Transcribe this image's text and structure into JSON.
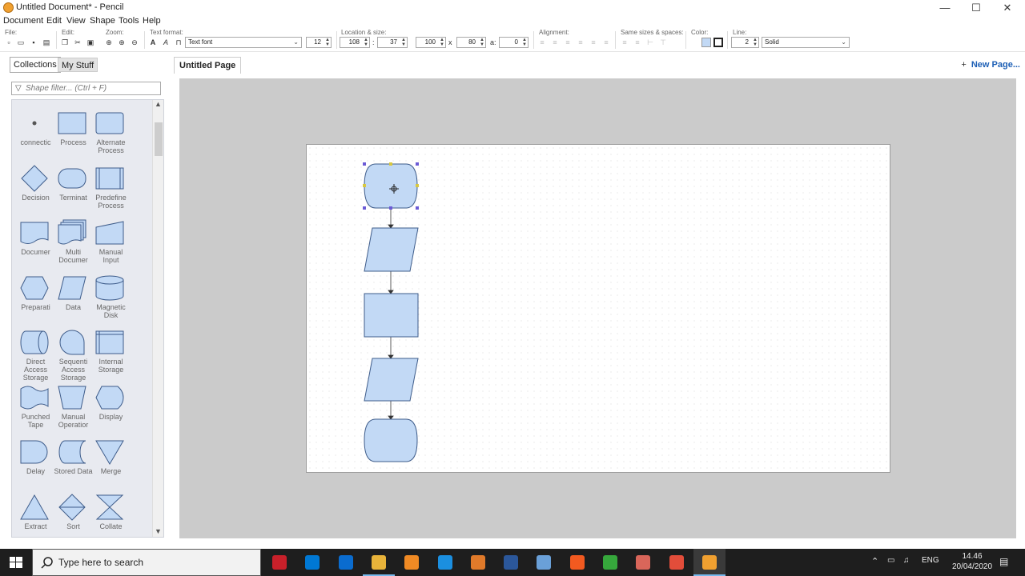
{
  "window": {
    "title": "Untitled Document* - Pencil",
    "minimize": "—",
    "maximize": "☐",
    "close": "✕"
  },
  "menu": [
    "Document",
    "Edit",
    "View",
    "Shape",
    "Tools",
    "Help"
  ],
  "toolbar": {
    "groups": {
      "file": "File:",
      "edit": "Edit:",
      "zoom": "Zoom:",
      "text_format": "Text format:",
      "location_size": "Location & size:",
      "alignment": "Alignment:",
      "same_sizes": "Same sizes & spaces:",
      "color": "Color:",
      "line": "Line:"
    },
    "font": "Text font",
    "font_size": "12",
    "x": "108",
    "colon": ":",
    "y": "37",
    "width": "100",
    "times": "x",
    "height": "80",
    "angle_label": "a:",
    "angle": "0",
    "line_width": "2",
    "line_style": "Solid",
    "fill_color": "#c2d9f5"
  },
  "left_panel": {
    "tabs": [
      "Collections",
      "My Stuff"
    ],
    "filter_placeholder": "Shape filter... (Ctrl + F)",
    "shapes": [
      {
        "label": "connectic",
        "shape": "connector"
      },
      {
        "label": "Process",
        "shape": "process"
      },
      {
        "label": "Alternate Process",
        "shape": "alternate-process"
      },
      {
        "label": "Decision",
        "shape": "decision"
      },
      {
        "label": "Terminat",
        "shape": "terminator"
      },
      {
        "label": "Predefine Process",
        "shape": "predefined-process"
      },
      {
        "label": "Documer",
        "shape": "document"
      },
      {
        "label": "Multi Documer",
        "shape": "multi-document"
      },
      {
        "label": "Manual Input",
        "shape": "manual-input"
      },
      {
        "label": "Preparati",
        "shape": "preparation"
      },
      {
        "label": "Data",
        "shape": "data"
      },
      {
        "label": "Magnetic Disk",
        "shape": "magnetic-disk"
      },
      {
        "label": "Direct Access Storage",
        "shape": "direct-access-storage"
      },
      {
        "label": "Sequenti Access Storage",
        "shape": "sequential-access-storage"
      },
      {
        "label": "Internal Storage",
        "shape": "internal-storage"
      },
      {
        "label": "Punched Tape",
        "shape": "punched-tape"
      },
      {
        "label": "Manual Operatior",
        "shape": "manual-operation"
      },
      {
        "label": "Display",
        "shape": "display"
      },
      {
        "label": "Delay",
        "shape": "delay"
      },
      {
        "label": "Stored Data",
        "shape": "stored-data"
      },
      {
        "label": "Merge",
        "shape": "merge"
      },
      {
        "label": "Extract",
        "shape": "extract"
      },
      {
        "label": "Sort",
        "shape": "sort"
      },
      {
        "label": "Collate",
        "shape": "collate"
      }
    ]
  },
  "page_tabs": {
    "active": "Untitled Page",
    "new_page": "New Page..."
  },
  "canvas": {
    "flow": [
      "terminator",
      "data",
      "process",
      "data",
      "terminator"
    ],
    "selected": "terminator-top"
  },
  "taskbar": {
    "search_placeholder": "Type here to search",
    "apps": [
      "gift-box",
      "store",
      "mail",
      "file-explorer",
      "sublime-text",
      "edge",
      "media-player",
      "word",
      "photos",
      "brave",
      "green-app",
      "paint-3d",
      "red-app",
      "pencil"
    ],
    "tray": {
      "language": "ENG",
      "time": "14.46",
      "date": "20/04/2020"
    }
  },
  "colors": {
    "shape_fill": "#c2d9f5",
    "shape_stroke": "#3e5c8a",
    "selection": "#6b5bd6",
    "accent": "#1d5fb5"
  }
}
